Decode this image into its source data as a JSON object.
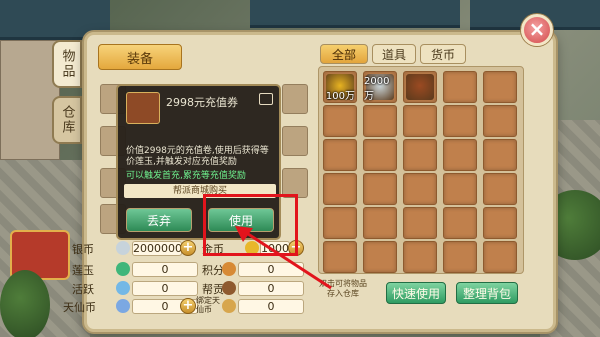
{
  "side_tabs": [
    {
      "label": "物品",
      "active": true
    },
    {
      "label": "仓库",
      "active": false
    }
  ],
  "equip_button": "装备",
  "category_tabs": [
    {
      "label": "全部",
      "active": true
    },
    {
      "label": "道具",
      "active": false
    },
    {
      "label": "货币",
      "active": false
    }
  ],
  "inventory": {
    "items": [
      {
        "name": "gold-ingot",
        "qty": "100万",
        "color": "#e7b321"
      },
      {
        "name": "silver-ingot",
        "qty": "2000万",
        "color": "#c9d4d8"
      },
      {
        "name": "recharge-voucher",
        "qty": "",
        "color": "#9b4a22"
      }
    ],
    "hint": "双击可将物品存入仓库",
    "buttons": [
      "快速使用",
      "整理背包"
    ]
  },
  "currencies": [
    {
      "label": "银币",
      "value": "20000000",
      "icon_color": "#c7d3db",
      "has_plus": true
    },
    {
      "label": "金币",
      "value": "1000000",
      "icon_color": "#e8b72b",
      "has_plus": true
    },
    {
      "label": "莲玉",
      "value": "0",
      "icon_color": "#3fb67a",
      "has_plus": false
    },
    {
      "label": "积分",
      "value": "0",
      "icon_color": "#d78a35",
      "has_plus": false
    },
    {
      "label": "活跃",
      "value": "0",
      "icon_color": "#73b8e6",
      "has_plus": false
    },
    {
      "label": "帮贡",
      "value": "0",
      "icon_color": "#8f5a2f",
      "has_plus": false
    },
    {
      "label": "天仙币",
      "value": "0",
      "icon_color": "#7ba8e2",
      "has_plus": true
    },
    {
      "label": "绑定天仙币",
      "value": "0",
      "icon_color": "#d7a64d",
      "has_plus": false
    }
  ],
  "tooltip": {
    "title": "2998元充值券",
    "description": "价值2998元的充值卷,使用后获得等价莲玉,并触发对应充值奖励",
    "green_note": "可以触发首充,累充等充值奖励",
    "shop_bar": "帮派商城购买",
    "discard_button": "丢弃",
    "use_button": "使用"
  },
  "close_symbol": "×",
  "colors": {
    "highlight": "#e2141c",
    "green_button": "#2f9c62",
    "gold_button": "#e3a53c"
  }
}
